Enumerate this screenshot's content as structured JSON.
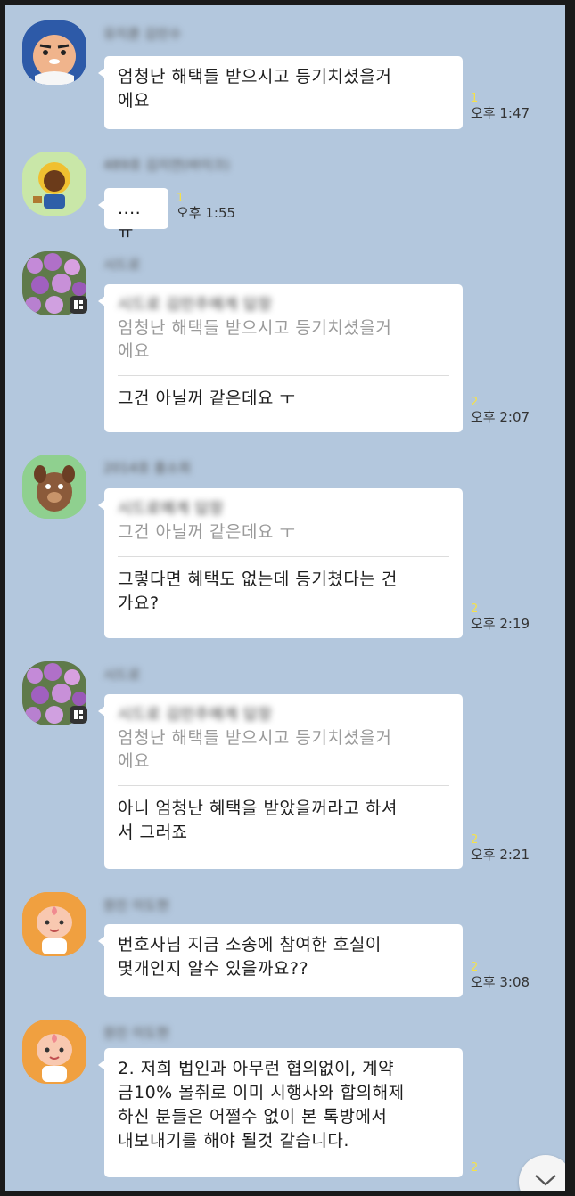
{
  "colors": {
    "background": "#b3c7dd",
    "bubble": "#ffffff",
    "unread": "#f5e14a"
  },
  "messages": [
    {
      "sender": "유지훈 김민수",
      "avatar": "ryan-avatar",
      "lines": [
        "엄청난 해택들 받으시고 등기치셨을거",
        "에요"
      ],
      "unread": "1",
      "time": "오후 1:47"
    },
    {
      "sender": "489호 김지연(바이크)",
      "avatar": "muzi-avatar",
      "lines": [
        "....ㅠ"
      ],
      "unread": "1",
      "time": "오후 1:55"
    },
    {
      "sender": "시드로",
      "avatar": "flower-avatar",
      "reply_to": "시드로 김민주에게 답장",
      "quoted": [
        "엄청난 해택들 받으시고 등기치셨을거",
        "에요"
      ],
      "lines": [
        "그건 아닐꺼 같은데요 ㅜ"
      ],
      "unread": "2",
      "time": "오후 2:07"
    },
    {
      "sender": "2014호 홍소희",
      "avatar": "frodo-avatar",
      "reply_to": "시드로에게 답장",
      "quoted": [
        "그건 아닐꺼 같은데요 ㅜ"
      ],
      "lines": [
        "그렇다면 혜택도 없는데 등기쳤다는 건",
        "가요?"
      ],
      "unread": "2",
      "time": "오후 2:19"
    },
    {
      "sender": "시드로",
      "avatar": "flower-avatar",
      "reply_to": "시드로 김민주에게 답장",
      "quoted": [
        "엄청난 해택들 받으시고 등기치셨을거",
        "에요"
      ],
      "lines": [
        "아니 엄청난 혜택을 받았을꺼라고 하셔",
        "서 그러죠"
      ],
      "unread": "2",
      "time": "오후 2:21"
    },
    {
      "sender": "원진 이도현",
      "avatar": "apeach-avatar",
      "lines": [
        "번호사님 지금 소송에 참여한 호실이",
        "몇개인지 알수 있을까요??"
      ],
      "unread": "2",
      "time": "오후 3:08"
    },
    {
      "sender": "원진 이도현",
      "avatar": "apeach-avatar",
      "lines": [
        "2. 저희 법인과 아무런 협의없이, 계약",
        "금10% 몰취로 이미 시행사와 합의해제",
        "하신 분들은 어쩔수 없이 본 톡방에서",
        "내보내기를 해야 될것 같습니다."
      ],
      "unread": "2",
      "time": ""
    }
  ],
  "scroll_button": {
    "icon": "chevron-down-icon"
  }
}
